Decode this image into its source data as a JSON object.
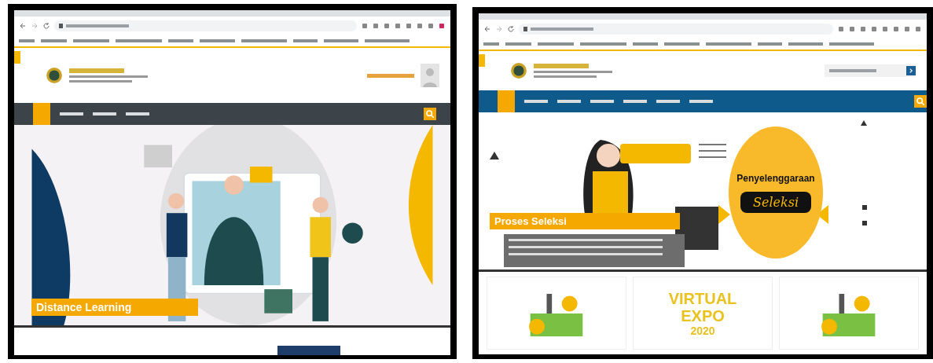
{
  "windows": [
    {
      "kind": "dark-nav",
      "hero_caption": "Distance Learning"
    },
    {
      "kind": "blue-nav",
      "hero_caption": "Proses Seleksi",
      "badge_title": "Penyelenggaraan",
      "badge_subtitle": "Seleksi",
      "cards": [
        {
          "kind": "picture"
        },
        {
          "kind": "expo",
          "title": "VIRTUAL EXPO",
          "year": "2020"
        },
        {
          "kind": "picture"
        }
      ]
    }
  ]
}
